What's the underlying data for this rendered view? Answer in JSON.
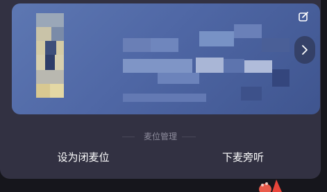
{
  "panel": {
    "section_title": "麦位管理",
    "actions": [
      {
        "label": "设为闭麦位"
      },
      {
        "label": "下麦旁听"
      }
    ]
  },
  "profile_card": {
    "content": "blurred",
    "edit_icon": "edit-icon",
    "next_icon": "chevron-right-icon"
  },
  "colors": {
    "panel_bg": "#323142",
    "card_bg": "#5670ad",
    "text_primary": "#ffffff",
    "text_secondary": "#8d8c9c"
  }
}
